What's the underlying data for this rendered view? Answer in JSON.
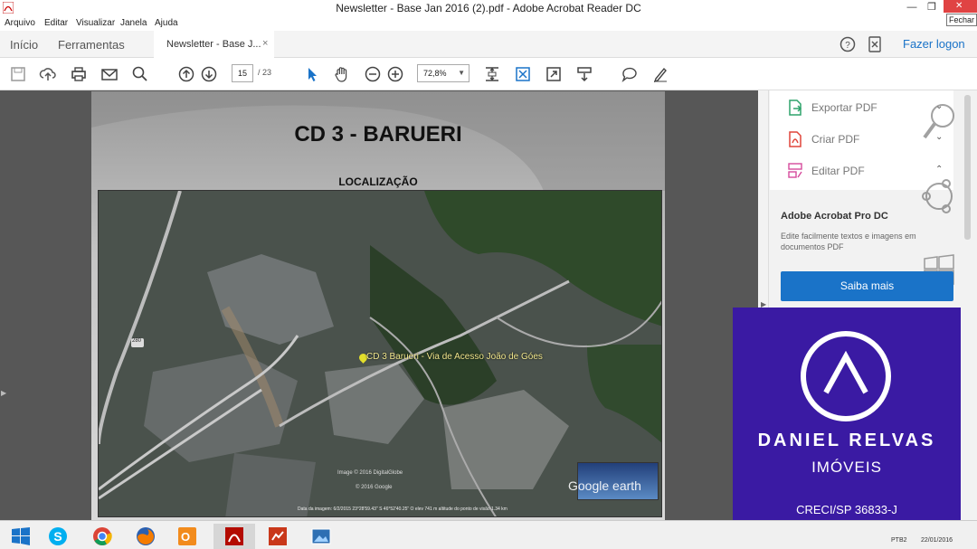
{
  "window": {
    "title": "Newsletter - Base Jan  2016 (2).pdf - Adobe Acrobat Reader DC",
    "minimize_glyph": "—",
    "restore_glyph": "❐",
    "close_glyph": "✕",
    "close_tooltip": "Fechar"
  },
  "menubar": {
    "items": [
      "Arquivo",
      "Editar",
      "Visualizar",
      "Janela",
      "Ajuda"
    ]
  },
  "tabs": {
    "home": "Início",
    "tools": "Ferramentas",
    "document": "Newsletter - Base J...",
    "close_tab": "×",
    "login": "Fazer logon"
  },
  "toolbar": {
    "icons": [
      "save-icon",
      "upload-icon",
      "print-icon",
      "email-icon",
      "search-icon",
      "prev-page-icon",
      "next-page-icon",
      "select-cursor-icon",
      "hand-tool-icon",
      "zoom-out-icon",
      "zoom-in-icon",
      "fit-page-icon",
      "full-screen-icon",
      "read-mode-icon",
      "scroll-mode-icon",
      "comment-icon",
      "sign-icon"
    ],
    "page_current": "15",
    "page_total": "/ 23",
    "zoom": "72,8%",
    "accent": "#1a73c8"
  },
  "document": {
    "page_title": "CD 3 - BARUERI",
    "page_subtitle": "LOCALIZAÇÃO",
    "map": {
      "placemark_label": "CD 3 Barueri - Via de Acesso João de Góes",
      "road_number": "280",
      "credit_1": "Image © 2016 DigitalGlobe",
      "credit_2": "© 2016 Google",
      "logo": "Google earth",
      "footer": "Data da imagem: 6/2/2015   23°28'59.43\" S  46°52'40.25\" O  elev  741 m   altitude do ponto de visão  1.34 km"
    }
  },
  "rightpane": {
    "tools": [
      {
        "icon": "export-pdf-icon",
        "label": "Exportar PDF",
        "color": "#2ea36b"
      },
      {
        "icon": "create-pdf-icon",
        "label": "Criar PDF",
        "color": "#e0453a"
      },
      {
        "icon": "edit-pdf-icon",
        "label": "Editar PDF",
        "color": "#d64b9c"
      }
    ],
    "promo_title": "Adobe Acrobat Pro DC",
    "promo_text": "Edite facilmente textos e imagens em documentos PDF",
    "promo_button": "Saiba mais"
  },
  "brand": {
    "name": "DANIEL RELVAS",
    "sub": "IMÓVEIS",
    "creci": "CRECI/SP 36833-J",
    "background": "#3a1aa3"
  },
  "taskbar": {
    "apps": [
      "windows-start-icon",
      "skype-icon",
      "chrome-icon",
      "firefox-icon",
      "outlook-icon",
      "acrobat-icon",
      "powerpoint-icon",
      "photo-viewer-icon"
    ],
    "lang": "PTB2",
    "date": "22/01/2016"
  }
}
